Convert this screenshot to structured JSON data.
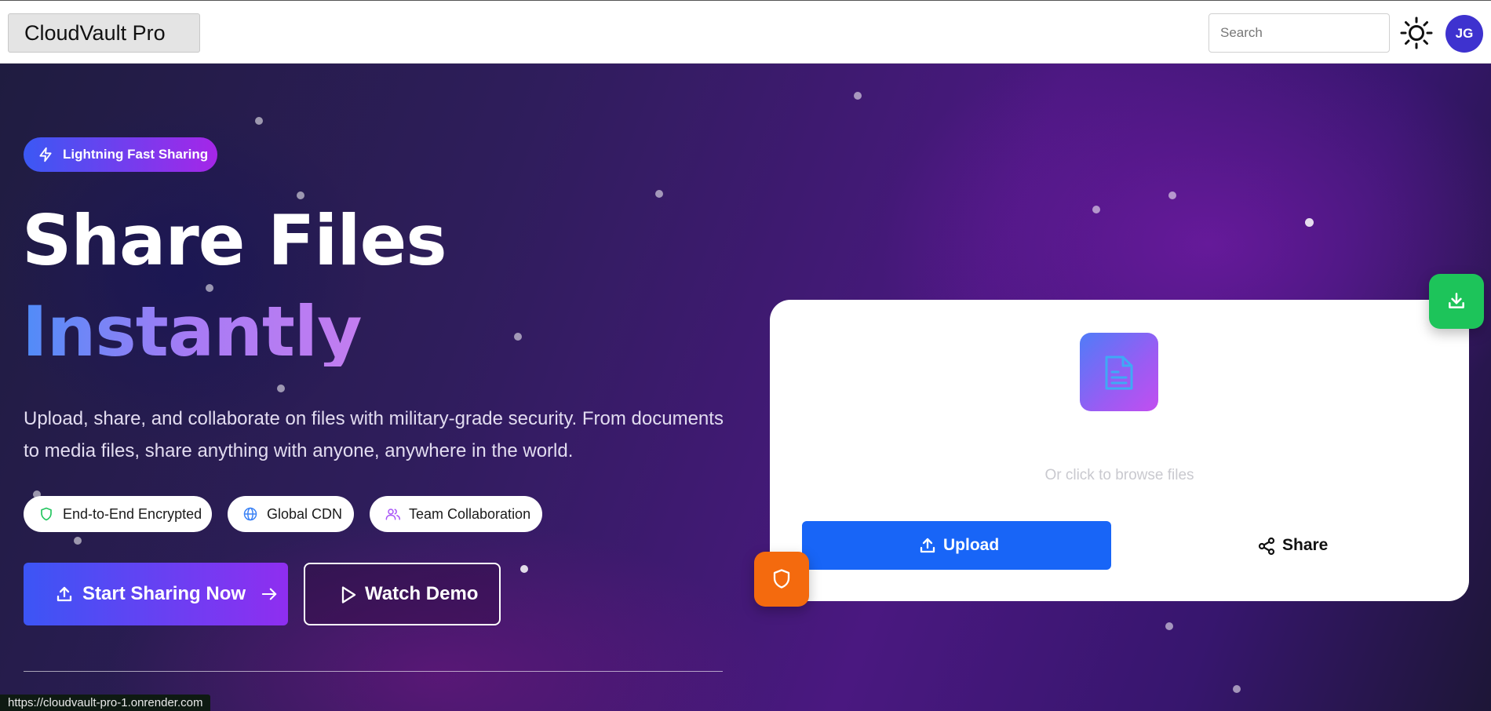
{
  "navbar": {
    "brand": "CloudVault Pro",
    "search_placeholder": "Search",
    "avatar_initials": "JG"
  },
  "hero": {
    "badge": "Lightning Fast Sharing",
    "title_line1": "Share Files",
    "title_line2": "Instantly",
    "description": "Upload, share, and collaborate on files with military-grade security. From documents to media files, share anything with anyone, anywhere in the world.",
    "features": [
      {
        "label": "End-to-End Encrypted",
        "icon": "shield-icon",
        "color": "#22c55e"
      },
      {
        "label": "Global CDN",
        "icon": "globe-icon",
        "color": "#3b82f6"
      },
      {
        "label": "Team Collaboration",
        "icon": "users-icon",
        "color": "#a855f7"
      }
    ],
    "primary_cta": "Start Sharing Now",
    "secondary_cta": "Watch Demo"
  },
  "upload_card": {
    "browse_text": "Or click to browse files",
    "upload_label": "Upload",
    "share_label": "Share"
  },
  "colors": {
    "upload_button": "#1865f7",
    "download_float": "#1dc45a",
    "security_float": "#f46a0e",
    "avatar": "#3e32cf"
  },
  "status_bar": {
    "url": "https://cloudvault-pro-1.onrender.com"
  }
}
